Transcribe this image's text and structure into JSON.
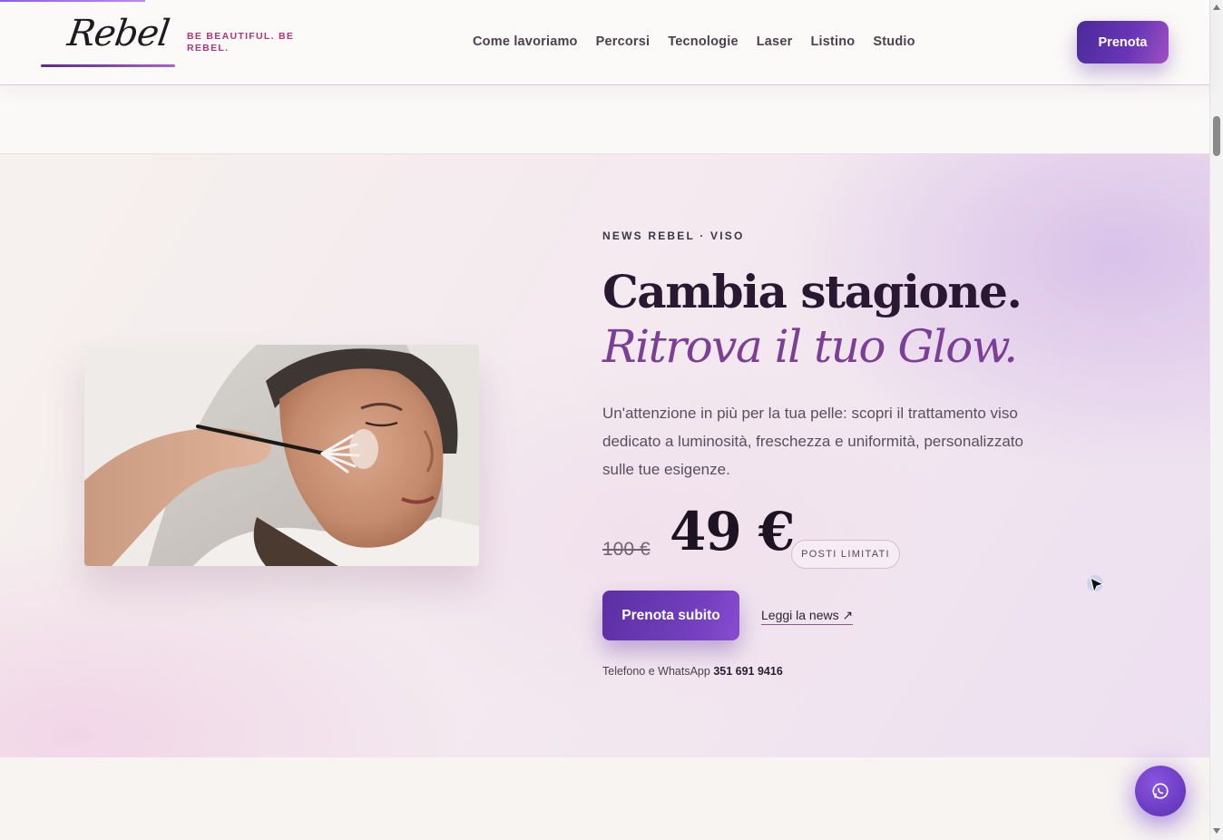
{
  "header": {
    "logo_text": "Rebel",
    "tagline": "BE BEAUTIFUL. BE REBEL.",
    "nav": [
      "Come lavoriamo",
      "Percorsi",
      "Tecnologie",
      "Laser",
      "Listino",
      "Studio"
    ],
    "cta_label": "Prenota"
  },
  "hero": {
    "kicker": "NEWS REBEL · VISO",
    "title_line1": "Cambia stagione.",
    "title_line2": "Ritrova il tuo Glow.",
    "lead": "Un'attenzione in più per la tua pelle: scopri il trattamento viso dedicato a luminosità, freschezza e uniformità, personalizzato sulle tue esigenze.",
    "price_old": "100 €",
    "price_new": "49 €",
    "badge": "POSTI LIMITATI",
    "cta_label": "Prenota subito",
    "news_link": "Leggi la news ↗",
    "contact_label": "Telefono e WhatsApp",
    "contact_number": "351 691 9416"
  },
  "icons": {
    "whatsapp": "whatsapp-icon",
    "cursor": "cursor-icon"
  },
  "colors": {
    "accent": "#6a36b8",
    "tagline": "#b0347a",
    "title_italic": "#7b3f96"
  }
}
